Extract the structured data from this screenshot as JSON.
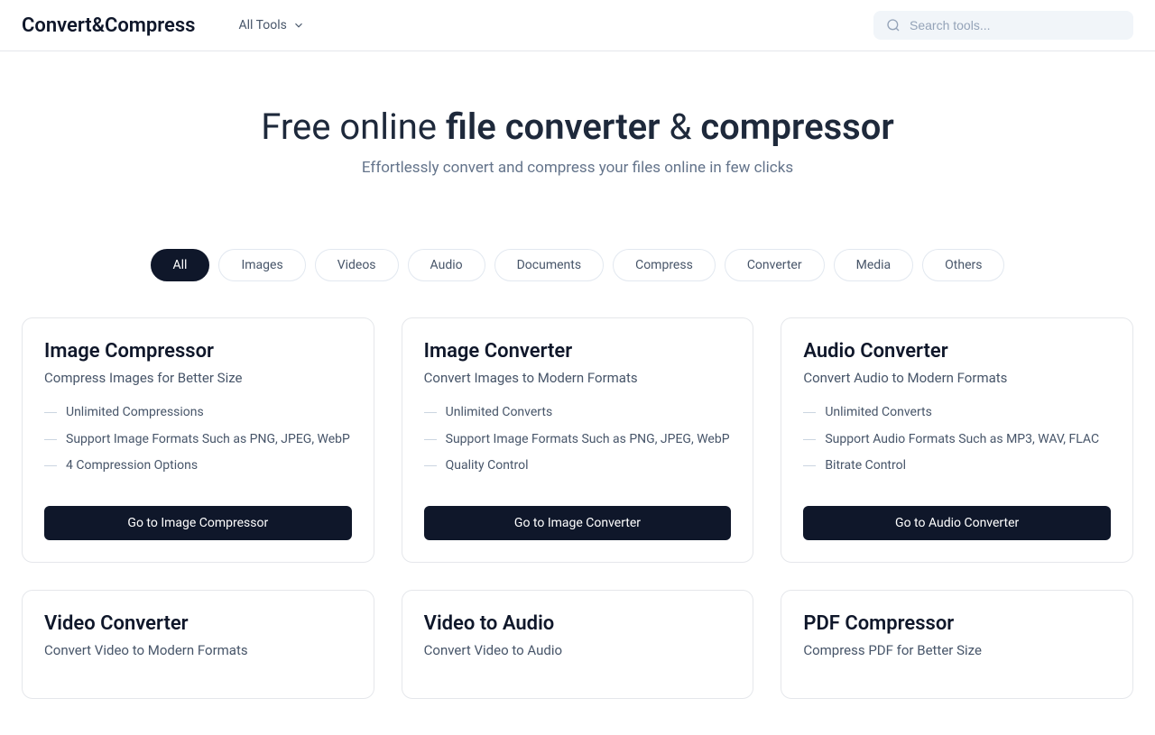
{
  "header": {
    "logo": "Convert&Compress",
    "all_tools_label": "All Tools",
    "search_placeholder": "Search tools..."
  },
  "hero": {
    "title_prefix": "Free online ",
    "title_strong1": "file converter",
    "title_mid": " & ",
    "title_strong2": "compressor",
    "subtitle": "Effortlessly convert and compress your files online in few clicks"
  },
  "filters": [
    {
      "label": "All",
      "active": true
    },
    {
      "label": "Images",
      "active": false
    },
    {
      "label": "Videos",
      "active": false
    },
    {
      "label": "Audio",
      "active": false
    },
    {
      "label": "Documents",
      "active": false
    },
    {
      "label": "Compress",
      "active": false
    },
    {
      "label": "Converter",
      "active": false
    },
    {
      "label": "Media",
      "active": false
    },
    {
      "label": "Others",
      "active": false
    }
  ],
  "cards": [
    {
      "title": "Image Compressor",
      "subtitle": "Compress Images for Better Size",
      "features": [
        "Unlimited Compressions",
        "Support Image Formats Such as PNG, JPEG, WebP",
        "4 Compression Options"
      ],
      "button": "Go to Image Compressor"
    },
    {
      "title": "Image Converter",
      "subtitle": "Convert Images to Modern Formats",
      "features": [
        "Unlimited Converts",
        "Support Image Formats Such as PNG, JPEG, WebP",
        "Quality Control"
      ],
      "button": "Go to Image Converter"
    },
    {
      "title": "Audio Converter",
      "subtitle": "Convert Audio to Modern Formats",
      "features": [
        "Unlimited Converts",
        "Support Audio Formats Such as MP3, WAV, FLAC",
        "Bitrate Control"
      ],
      "button": "Go to Audio Converter"
    },
    {
      "title": "Video Converter",
      "subtitle": "Convert Video to Modern Formats",
      "features": [],
      "button": ""
    },
    {
      "title": "Video to Audio",
      "subtitle": "Convert Video to Audio",
      "features": [],
      "button": ""
    },
    {
      "title": "PDF Compressor",
      "subtitle": "Compress PDF for Better Size",
      "features": [],
      "button": ""
    }
  ]
}
